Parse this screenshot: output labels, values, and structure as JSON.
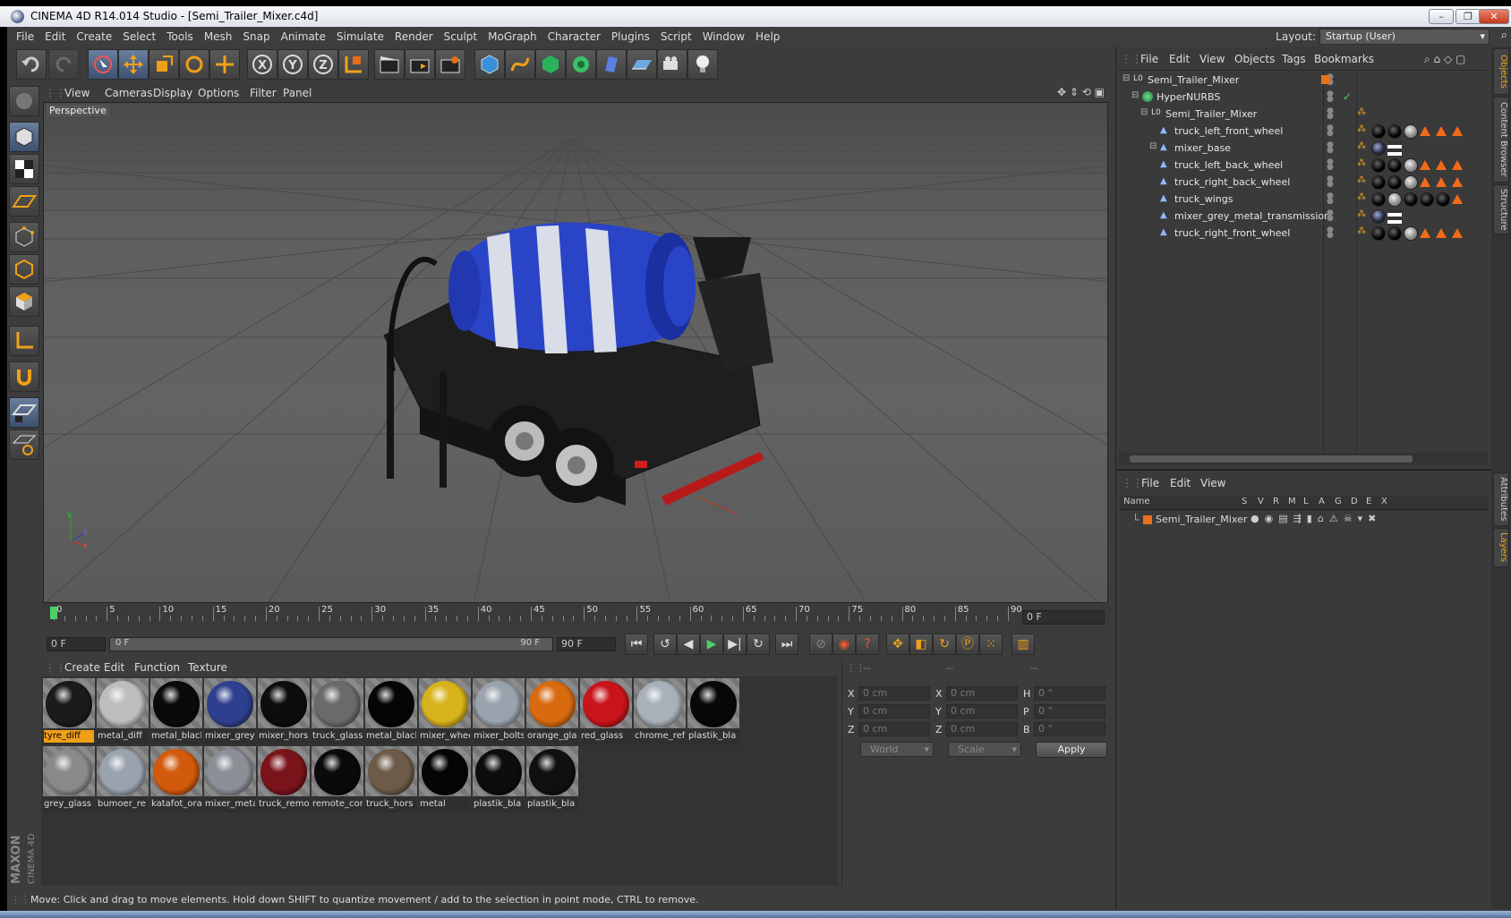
{
  "window": {
    "title": "CINEMA 4D R14.014 Studio - [Semi_Trailer_Mixer.c4d]",
    "min_label": "–",
    "max_label": "❐",
    "close_label": "✕"
  },
  "menubar": {
    "items": [
      "File",
      "Edit",
      "Create",
      "Select",
      "Tools",
      "Mesh",
      "Snap",
      "Animate",
      "Simulate",
      "Render",
      "Sculpt",
      "MoGraph",
      "Character",
      "Plugins",
      "Script",
      "Window",
      "Help"
    ],
    "layout_label": "Layout:",
    "layout_value": "Startup (User)"
  },
  "toolbar": {
    "axis_x": "X",
    "axis_y": "Y",
    "axis_z": "Z"
  },
  "viewport": {
    "menu": [
      "View",
      "Cameras",
      "Display",
      "Options",
      "Filter",
      "Panel"
    ],
    "camera_label": "Perspective"
  },
  "timeline": {
    "ticks": [
      "0",
      "5",
      "10",
      "15",
      "20",
      "25",
      "30",
      "35",
      "40",
      "45",
      "50",
      "55",
      "60",
      "65",
      "70",
      "75",
      "80",
      "85",
      "90"
    ],
    "current_frame": "0 F",
    "start_field": "0 F",
    "range_start": "0 F",
    "range_end": "90 F",
    "end_field": "90 F"
  },
  "materials": {
    "menu": [
      "Create",
      "Edit",
      "Function",
      "Texture"
    ],
    "items": [
      {
        "label": "tyre_diff",
        "color": "#1a1a1a"
      },
      {
        "label": "metal_diff",
        "color": "#bdbdbd"
      },
      {
        "label": "metal_blacl",
        "color": "#0a0a0a"
      },
      {
        "label": "mixer_grey_",
        "color": "#2f3f8f"
      },
      {
        "label": "mixer_hors",
        "color": "#0d0d0d"
      },
      {
        "label": "truck_glass",
        "color": "#6a6a6a"
      },
      {
        "label": "metal_blacl",
        "color": "#050505"
      },
      {
        "label": "mixer_whee",
        "color": "#d8b21a"
      },
      {
        "label": "mixer_bolts",
        "color": "#9aa3ad"
      },
      {
        "label": "orange_gla",
        "color": "#d86a10"
      },
      {
        "label": "red_glass",
        "color": "#c8141a"
      },
      {
        "label": "chrome_ref",
        "color": "#a8b0b8"
      },
      {
        "label": "plastik_bla",
        "color": "#080808"
      },
      {
        "label": "grey_glass",
        "color": "#8a8a8a"
      },
      {
        "label": "bumoer_re",
        "color": "#9aa3ad"
      },
      {
        "label": "katafot_ora",
        "color": "#d25a0c"
      },
      {
        "label": "mixer_meta",
        "color": "#8b9097"
      },
      {
        "label": "truck_remo",
        "color": "#7a141a"
      },
      {
        "label": "remote_cor",
        "color": "#0a0a0a"
      },
      {
        "label": "truck_hors",
        "color": "#6d5a48"
      },
      {
        "label": "metal",
        "color": "#050505"
      },
      {
        "label": "plastik_bla",
        "color": "#0d0d0d"
      },
      {
        "label": "plastik_bla",
        "color": "#101010"
      }
    ]
  },
  "coordinates": {
    "header": [
      "--",
      "--",
      "--"
    ],
    "pos_x_label": "X",
    "pos_y_label": "Y",
    "pos_z_label": "Z",
    "size_x_label": "X",
    "size_y_label": "Y",
    "size_z_label": "Z",
    "rot_h_label": "H",
    "rot_p_label": "P",
    "rot_b_label": "B",
    "pos_x": "0 cm",
    "pos_y": "0 cm",
    "pos_z": "0 cm",
    "size_x": "0 cm",
    "size_y": "0 cm",
    "size_z": "0 cm",
    "rot_h": "0 °",
    "rot_p": "0 °",
    "rot_b": "0 °",
    "mode": "World",
    "size_mode": "Scale",
    "apply": "Apply"
  },
  "objects": {
    "menu": [
      "File",
      "Edit",
      "View",
      "Objects",
      "Tags",
      "Bookmarks"
    ],
    "rows": [
      {
        "name": "Semi_Trailer_Mixer",
        "indent": 0,
        "type": "null"
      },
      {
        "name": "HyperNURBS",
        "indent": 1,
        "type": "hn"
      },
      {
        "name": "Semi_Trailer_Mixer",
        "indent": 2,
        "type": "null"
      },
      {
        "name": "truck_left_front_wheel",
        "indent": 3,
        "type": "poly"
      },
      {
        "name": "mixer_base",
        "indent": 3,
        "type": "poly"
      },
      {
        "name": "truck_left_back_wheel",
        "indent": 3,
        "type": "poly"
      },
      {
        "name": "truck_right_back_wheel",
        "indent": 3,
        "type": "poly"
      },
      {
        "name": "truck_wings",
        "indent": 3,
        "type": "poly"
      },
      {
        "name": "mixer_grey_metal_transmission",
        "indent": 3,
        "type": "poly"
      },
      {
        "name": "truck_right_front_wheel",
        "indent": 3,
        "type": "poly"
      }
    ]
  },
  "layers": {
    "menu": [
      "File",
      "Edit",
      "View"
    ],
    "columns": [
      "Name",
      "S",
      "V",
      "R",
      "M",
      "L",
      "A",
      "G",
      "D",
      "E",
      "X"
    ],
    "rows": [
      {
        "name": "Semi_Trailer_Mixer",
        "color": "#e8701a"
      }
    ]
  },
  "side_tabs": [
    "Objects",
    "Content Browser",
    "Structure",
    "Attributes",
    "Layers"
  ],
  "status": {
    "message": "Move: Click and drag to move elements. Hold down SHIFT to quantize movement / add to the selection in point mode, CTRL to remove."
  },
  "brand": {
    "maxon": "MAXON",
    "product": "CINEMA 4D"
  },
  "colors": {
    "accent": "#f0a018",
    "mixer_blue": "#2a44c8",
    "tag_orange": "#f26a1a"
  }
}
